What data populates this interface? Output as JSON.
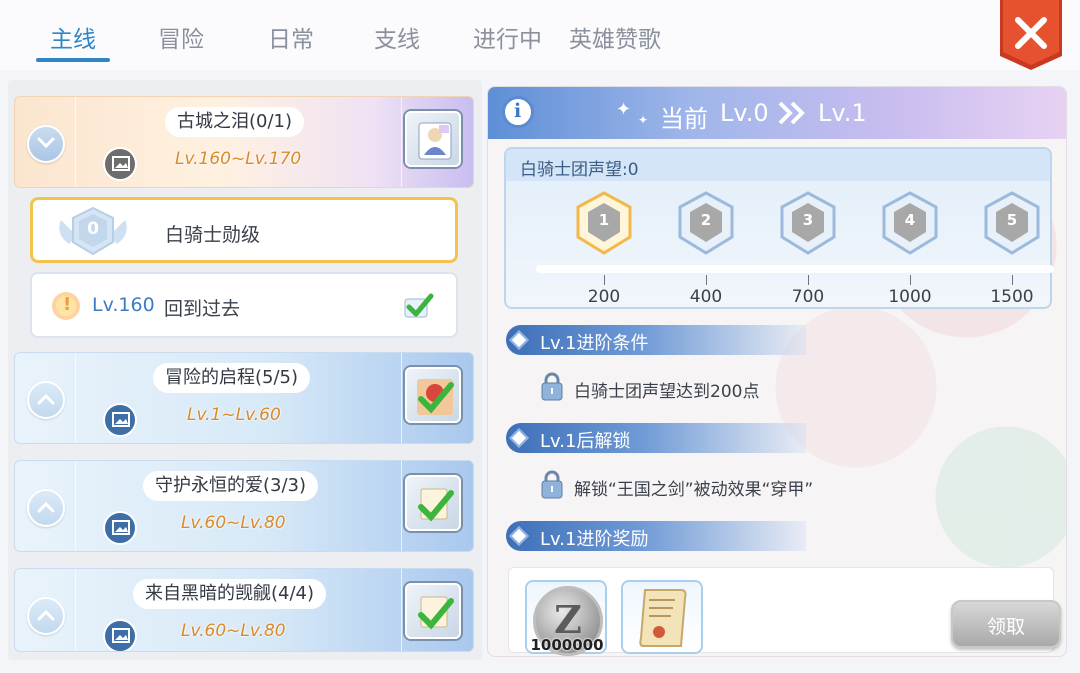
{
  "tabs": [
    {
      "label": "主线",
      "active": true
    },
    {
      "label": "冒险",
      "active": false
    },
    {
      "label": "日常",
      "active": false
    },
    {
      "label": "支线",
      "active": false
    },
    {
      "label": "进行中",
      "active": false
    },
    {
      "label": "英雄赞歌",
      "active": false
    }
  ],
  "close_icon": "close-x-icon",
  "quests": [
    {
      "title": "古城之泪(0/1)",
      "levels": "Lv.160~Lv.170",
      "expanded": true,
      "thumb_icon": "hero-card-icon"
    },
    {
      "title": "冒险的启程(5/5)",
      "levels": "Lv.1~Lv.60",
      "expanded": false,
      "thumb_icon": "completed-check-icon"
    },
    {
      "title": "守护永恒的爱(3/3)",
      "levels": "Lv.60~Lv.80",
      "expanded": false,
      "thumb_icon": "completed-check-icon"
    },
    {
      "title": "来自黑暗的觊觎(4/4)",
      "levels": "Lv.60~Lv.80",
      "expanded": false,
      "thumb_icon": "completed-check-icon"
    }
  ],
  "subquests": [
    {
      "badge": "0",
      "label": "白骑士勋级",
      "selected": true
    },
    {
      "level": "Lv.160",
      "label": "回到过去",
      "done": true
    }
  ],
  "detail": {
    "title_prefix": "当前",
    "from_level": "Lv.0",
    "to_level": "Lv.1",
    "reputation_label": "白骑士团声望:0",
    "reputation_value": 0,
    "milestones": [
      {
        "rank": "1",
        "value": "200"
      },
      {
        "rank": "2",
        "value": "400"
      },
      {
        "rank": "3",
        "value": "700"
      },
      {
        "rank": "4",
        "value": "1000"
      },
      {
        "rank": "5",
        "value": "1500"
      }
    ],
    "sections": {
      "condition_title": "Lv.1进阶条件",
      "condition_text": "白骑士团声望达到200点",
      "unlock_title": "Lv.1后解锁",
      "unlock_text": "解锁“王国之剑”被动效果“穿甲”",
      "reward_title": "Lv.1进阶奖励"
    },
    "rewards": [
      {
        "icon": "zeny-coin-icon",
        "count": "1000000"
      },
      {
        "icon": "scroll-icon",
        "count": ""
      }
    ],
    "claim_label": "领取"
  },
  "colors": {
    "accent": "#2f86c7",
    "close_red": "#e0462a",
    "level_orange": "#d98a2a"
  }
}
